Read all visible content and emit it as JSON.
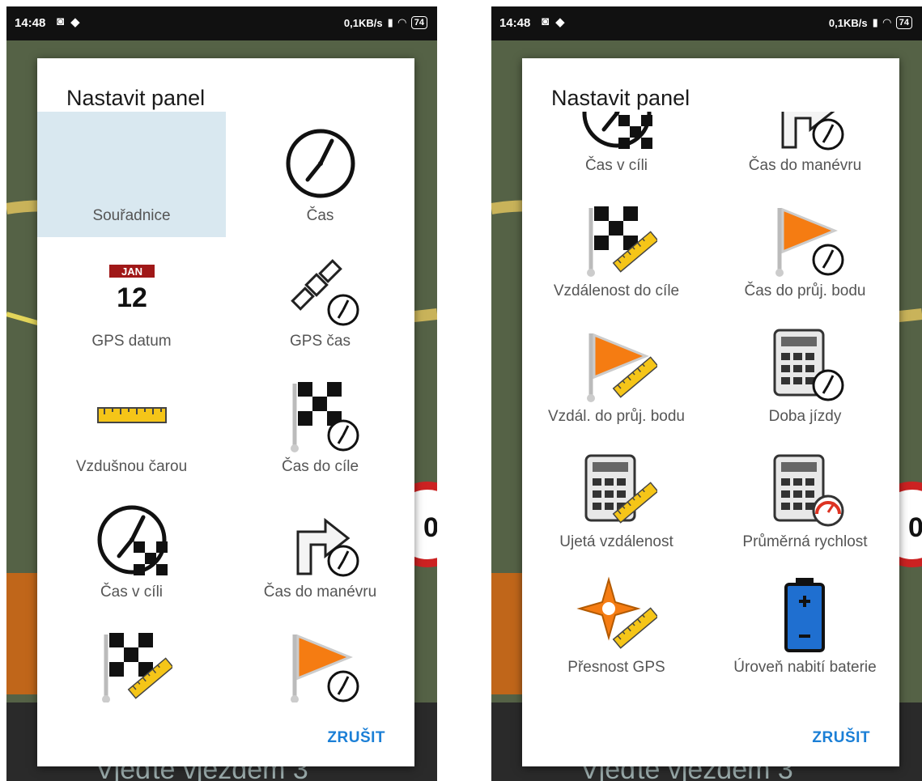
{
  "status_bar": {
    "time": "14:48",
    "speed": "0,1KB/s",
    "battery": "74"
  },
  "dialog": {
    "title": "Nastavit panel",
    "cancel_label": "ZRUŠIT"
  },
  "background": {
    "bottom_text": "Vjeďte vjezdem 3",
    "speed_limit_fragment": "0"
  },
  "left_items": [
    {
      "label": "Souřadnice",
      "icon": "blank",
      "selected": true
    },
    {
      "label": "Čas",
      "icon": "clock-icon"
    },
    {
      "label": "GPS datum",
      "icon": "calendar-icon",
      "calendar_month": "JAN",
      "calendar_day": "12"
    },
    {
      "label": "GPS čas",
      "icon": "satellite-clock-icon"
    },
    {
      "label": "Vzdušnou čarou",
      "icon": "ruler-icon"
    },
    {
      "label": "Čas do cíle",
      "icon": "finish-flag-clock-icon"
    },
    {
      "label": "Čas v cíli",
      "icon": "clock-finish-icon"
    },
    {
      "label": "Čas do manévru",
      "icon": "turn-arrow-clock-icon"
    },
    {
      "label": "",
      "icon": "finish-flag-ruler-icon"
    },
    {
      "label": "",
      "icon": "waypoint-flag-clock-icon"
    }
  ],
  "right_items": [
    {
      "label": "Čas v cíli",
      "icon": "clock-finish-icon"
    },
    {
      "label": "Čas do manévru",
      "icon": "turn-arrow-clock-icon"
    },
    {
      "label": "Vzdálenost do cíle",
      "icon": "finish-flag-ruler-icon"
    },
    {
      "label": "Čas do průj. bodu",
      "icon": "waypoint-flag-clock-icon"
    },
    {
      "label": "Vzdál. do průj. bodu",
      "icon": "waypoint-flag-ruler-icon"
    },
    {
      "label": "Doba jízdy",
      "icon": "calculator-clock-icon"
    },
    {
      "label": "Ujetá vzdálenost",
      "icon": "calculator-ruler-icon"
    },
    {
      "label": "Průměrná rychlost",
      "icon": "calculator-gauge-icon"
    },
    {
      "label": "Přesnost GPS",
      "icon": "gps-accuracy-icon"
    },
    {
      "label": "Úroveň nabití baterie",
      "icon": "battery-icon"
    }
  ]
}
